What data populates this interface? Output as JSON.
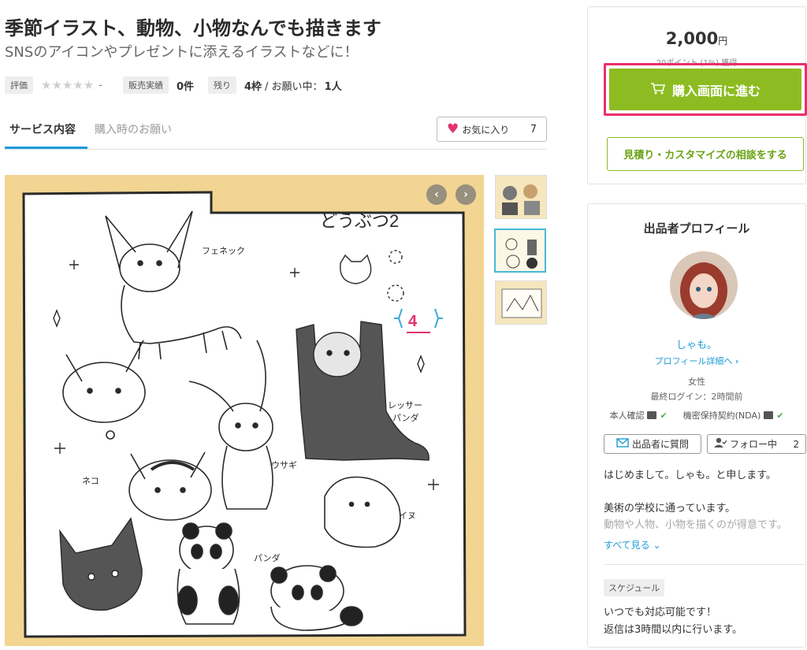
{
  "service": {
    "title": "季節イラスト、動物、小物なんでも描きます",
    "subtitle": "SNSのアイコンやプレゼントに添えるイラストなどに！",
    "rating_label": "評価",
    "rating_value": "-",
    "sales_label": "販売実績",
    "sales_value": "0件",
    "remaining_label": "残り",
    "remaining_value": "4枠",
    "requests_text": "/ お願い中：",
    "requests_value": "1人"
  },
  "tabs": {
    "service_content": "サービス内容",
    "purchase_request": "購入時のお願い"
  },
  "favorite": {
    "label": "お気に入り",
    "count": "7"
  },
  "image": {
    "doodle_title": "どうぶつ2",
    "badge_number": "4",
    "labels": {
      "fennec": "フェネック",
      "lesser_panda_1": "レッサー",
      "lesser_panda_2": "パンダ",
      "rabbit": "ウサギ",
      "cat": "ネコ",
      "dog": "イヌ",
      "panda": "パンダ"
    }
  },
  "purchase": {
    "price": "2,000",
    "currency": "円",
    "points": "20ポイント (1%) 獲得",
    "buy_label": "購入画面に進む",
    "consult_label": "見積り・カスタマイズの相談をする"
  },
  "profile": {
    "heading": "出品者プロフィール",
    "name": "しゃも。",
    "detail_link": "プロフィール詳細へ",
    "gender": "女性",
    "last_login": "最終ログイン：2時間前",
    "identity_label": "本人確認",
    "nda_label": "機密保持契約(NDA)",
    "question_label": "出品者に質問",
    "follow_label": "フォロー中",
    "follow_count": "2",
    "bio_line1": "はじめまして。しゃも。と申します。",
    "bio_line2": "美術の学校に通っています。",
    "bio_line3": "動物や人物、小物を描くのが得意です。",
    "see_all": "すべて見る",
    "schedule_label": "スケジュール",
    "schedule_line1": "いつでも対応可能です！",
    "schedule_line2": "返信は3時間以内に行います。"
  },
  "colors": {
    "accent_blue": "#1e9bd7",
    "buy_green": "#8cbc21",
    "highlight_pink": "#ea2f6a",
    "heart": "#e2336b",
    "image_background": "#f2d592"
  }
}
